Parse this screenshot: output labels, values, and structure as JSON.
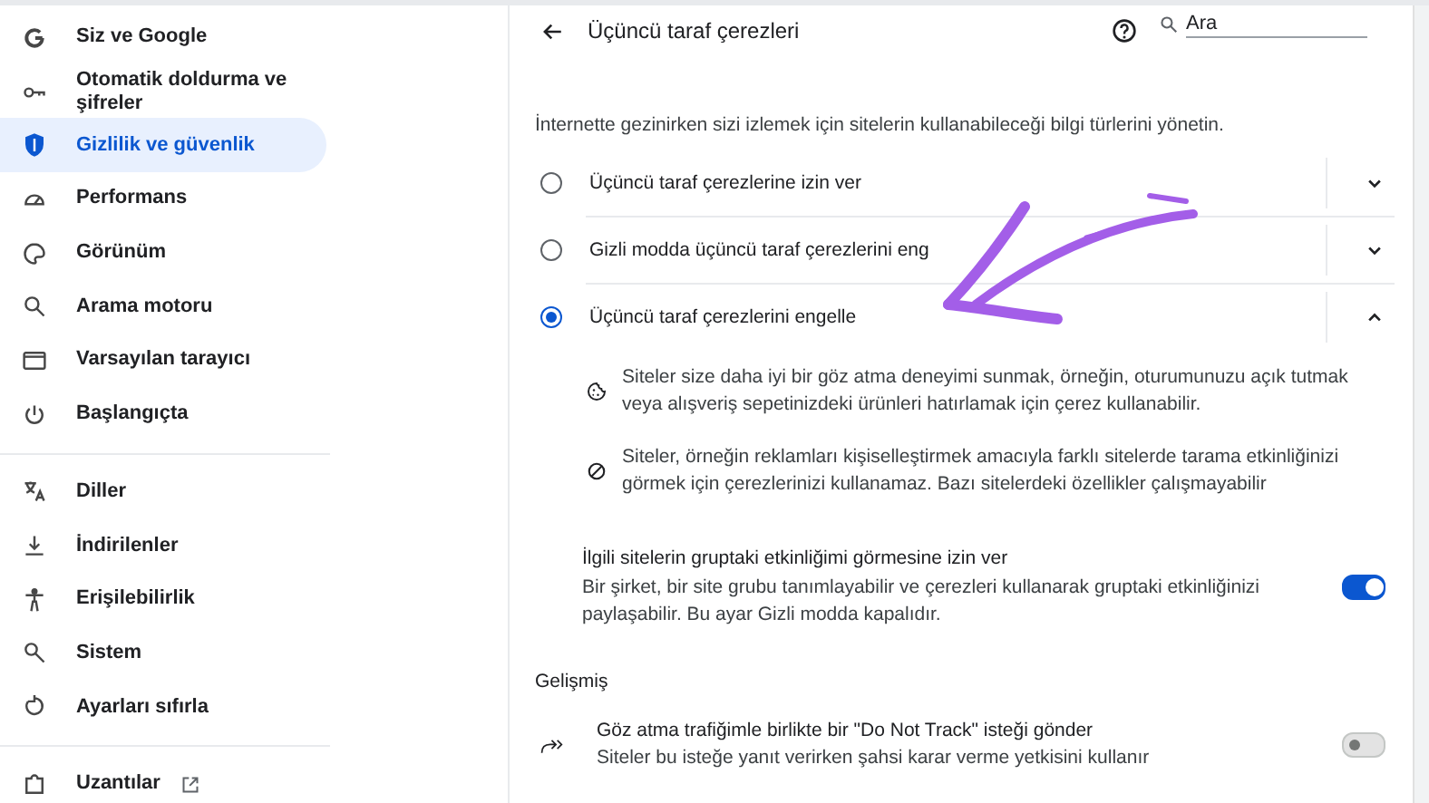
{
  "sidebar": {
    "sections": [
      {
        "items": [
          {
            "label": "Siz ve Google",
            "selected": false
          },
          {
            "label": "Otomatik doldurma ve şifreler",
            "selected": false
          },
          {
            "label": "Gizlilik ve güvenlik",
            "selected": true
          },
          {
            "label": "Performans",
            "selected": false
          },
          {
            "label": "Görünüm",
            "selected": false
          },
          {
            "label": "Arama motoru",
            "selected": false
          },
          {
            "label": "Varsayılan tarayıcı",
            "selected": false
          },
          {
            "label": "Başlangıçta",
            "selected": false
          }
        ]
      },
      {
        "items": [
          {
            "label": "Diller",
            "selected": false
          },
          {
            "label": "İndirilenler",
            "selected": false
          },
          {
            "label": "Erişilebilirlik",
            "selected": false
          },
          {
            "label": "Sistem",
            "selected": false
          },
          {
            "label": "Ayarları sıfırla",
            "selected": false
          }
        ]
      },
      {
        "items": [
          {
            "label": "Uzantılar",
            "selected": false
          }
        ]
      }
    ]
  },
  "header": {
    "title": "Üçüncü taraf çerezleri",
    "search": {
      "placeholder": "Ara"
    }
  },
  "description": "İnternette gezinirken sizi izlemek için sitelerin kullanabileceği bilgi türlerini yönetin.",
  "options": [
    {
      "label": "Üçüncü taraf çerezlerine izin ver",
      "selected": false,
      "expanded": false
    },
    {
      "label": "Gizli modda üçüncü taraf çerezlerini eng",
      "selected": false,
      "expanded": false
    },
    {
      "label": "Üçüncü taraf çerezlerini engelle",
      "selected": true,
      "expanded": true,
      "details": [
        "Siteler size daha iyi bir göz atma deneyimi sunmak, örneğin, oturumunuzu açık tutmak veya alışveriş sepetinizdeki ürünleri hatırlamak için çerez kullanabilir.",
        "Siteler, örneğin reklamları kişiselleştirmek amacıyla farklı sitelerde tarama etkinliğinizi görmek için çerezlerinizi kullanamaz. Bazı sitelerdeki özellikler çalışmayabilir"
      ]
    }
  ],
  "related_sites": {
    "title": "İlgili sitelerin gruptaki etkinliğimi görmesine izin ver",
    "description": "Bir şirket, bir site grubu tanımlayabilir ve çerezleri kullanarak gruptaki etkinliğinizi paylaşabilir. Bu ayar Gizli modda kapalıdır.",
    "on": true
  },
  "advanced": {
    "heading": "Gelişmiş",
    "do_not_track": {
      "title": "Göz atma trafiğimle birlikte bir \"Do Not Track\" isteği gönder",
      "description": "Siteler bu isteğe yanıt verirken şahsi karar verme yetkisini kullanır",
      "on": false
    }
  }
}
